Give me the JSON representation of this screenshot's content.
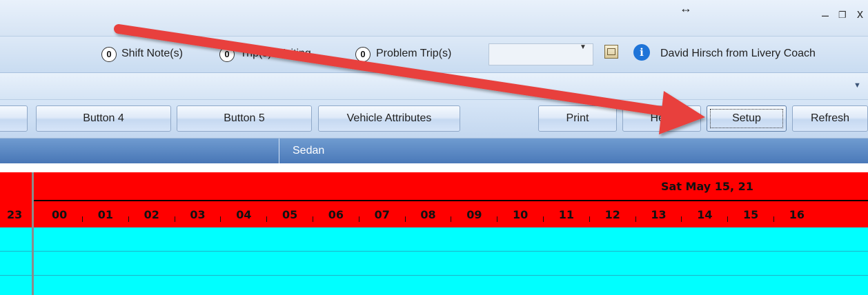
{
  "window": {
    "resize_glyph": "↔",
    "minimize": "–",
    "restore": "❐",
    "close": "x"
  },
  "status": {
    "shift_notes": {
      "count": "0",
      "label": "Shift Note(s)"
    },
    "trips_waiting": {
      "count": "0",
      "label": "Trip(s) Waiting"
    },
    "problem_trips": {
      "count": "0",
      "label": "Problem Trip(s)"
    },
    "combo_value": "",
    "info_glyph": "i",
    "user": "David Hirsch from Livery Coach"
  },
  "ribbon": {
    "collapse_glyph": "▼"
  },
  "toolbar": {
    "button3": "",
    "button4": "Button 4",
    "button5": "Button 5",
    "vehicle_attributes": "Vehicle Attributes",
    "print": "Print",
    "help": "Help",
    "setup": "Setup",
    "refresh": "Refresh"
  },
  "group": {
    "label": "Sedan"
  },
  "timeline": {
    "date": "Sat May 15, 21",
    "prev_hour": "23",
    "hours": [
      "00",
      "01",
      "02",
      "03",
      "04",
      "05",
      "06",
      "07",
      "08",
      "09",
      "10",
      "11",
      "12",
      "13",
      "14",
      "15",
      "16"
    ]
  },
  "icons": {
    "combo_arrow": "chevron-down-icon",
    "calendar": "calendar-icon",
    "info": "info-icon"
  },
  "colors": {
    "timeline_bg": "#ff0000",
    "grid_bg": "#00ffff",
    "group_bar": "#4a79b9",
    "annotation_arrow": "#e8403c"
  }
}
